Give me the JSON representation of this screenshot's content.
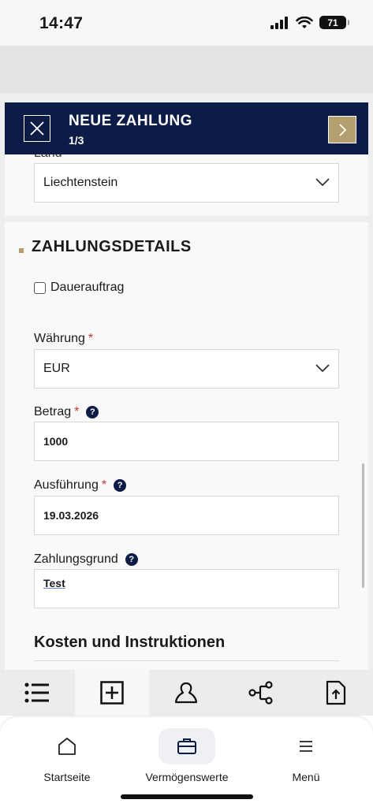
{
  "status_bar": {
    "time": "14:47",
    "battery": "71"
  },
  "header": {
    "title": "NEUE ZAHLUNG",
    "step": "1/3"
  },
  "address": {
    "country_label_cut": "Land",
    "country_value": "Liechtenstein"
  },
  "payment_details": {
    "section_title": "ZAHLUNGSDETAILS",
    "standing_order_label": "Dauerauftrag",
    "currency": {
      "label": "Währung",
      "required_mark": "*",
      "value": "EUR"
    },
    "amount": {
      "label": "Betrag",
      "required_mark": "*",
      "help": "?",
      "value": "1000"
    },
    "execution": {
      "label": "Ausführung",
      "required_mark": "*",
      "help": "?",
      "value": "19.03.2026"
    },
    "reason": {
      "label": "Zahlungsgrund",
      "help": "?",
      "value": "Test"
    },
    "costs_title": "Kosten und Instruktionen"
  },
  "toolbar": {
    "items": [
      "list-icon",
      "add-square-icon",
      "contact-icon",
      "share-nodes-icon",
      "upload-file-icon"
    ],
    "active_index": 1
  },
  "bottom_nav": {
    "items": [
      {
        "label": "Startseite",
        "icon": "home-icon"
      },
      {
        "label": "Vermögenswerte",
        "icon": "briefcase-icon"
      },
      {
        "label": "Menü",
        "icon": "menu-icon"
      }
    ],
    "active_index": 1
  },
  "colors": {
    "navy": "#0d1c46",
    "gold": "#b4a06e",
    "required": "#c0392b"
  }
}
